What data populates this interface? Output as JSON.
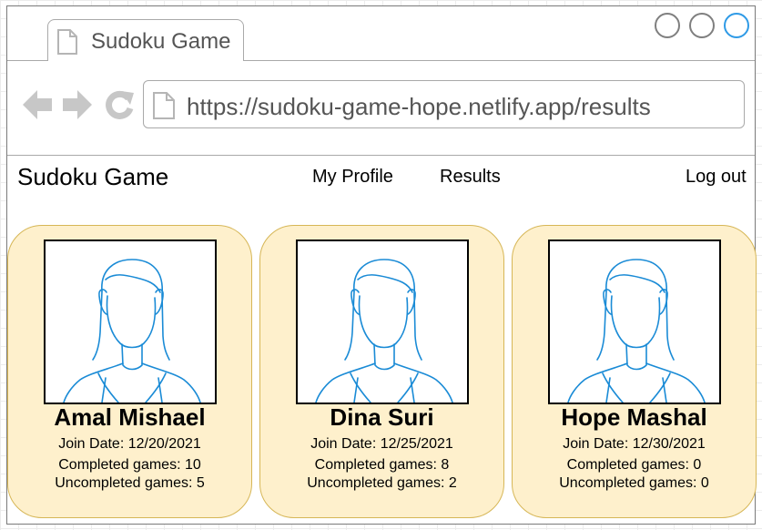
{
  "browser": {
    "tab_title": "Sudoku Game",
    "url": "https://sudoku-game-hope.netlify.app/results",
    "icons": [
      "page-icon",
      "back-arrow-icon",
      "forward-arrow-icon",
      "refresh-icon",
      "minimize-icon",
      "maximize-icon",
      "close-icon"
    ],
    "close_color": "#2e9ae6"
  },
  "app": {
    "title": "Sudoku Game",
    "nav": {
      "profile": "My Profile",
      "results": "Results",
      "logout": "Log out"
    }
  },
  "cards": [
    {
      "name": "Amal Mishael",
      "join": "Join Date: 12/20/2021",
      "completed": "Completed games: 10",
      "uncompleted": "Uncompleted games: 5"
    },
    {
      "name": "Dina Suri",
      "join": "Join Date: 12/25/2021",
      "completed": "Completed games: 8",
      "uncompleted": "Uncompleted games: 2"
    },
    {
      "name": "Hope Mashal",
      "join": "Join Date: 12/30/2021",
      "completed": "Completed games: 0",
      "uncompleted": "Uncompleted games: 0"
    }
  ],
  "colors": {
    "card_fill": "#fef0cc",
    "card_border": "#d6b656",
    "avatar_stroke": "#1a8bd6"
  }
}
